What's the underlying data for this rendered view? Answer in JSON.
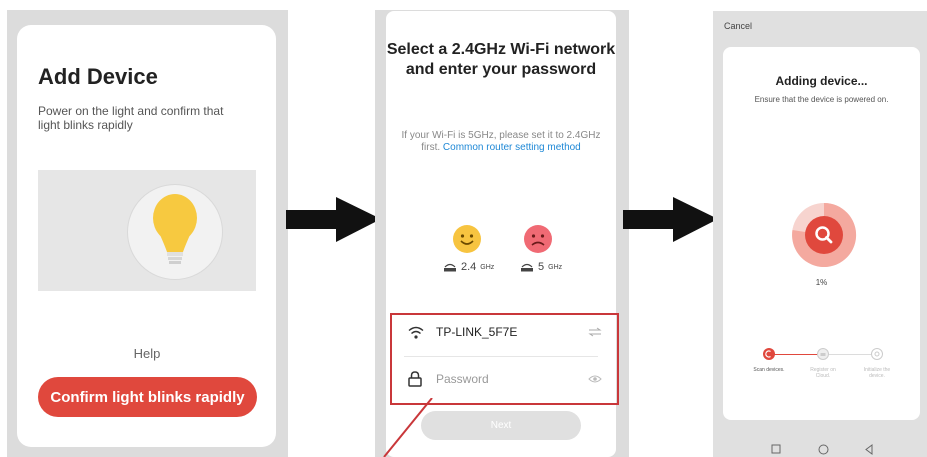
{
  "screen1": {
    "title": "Add Device",
    "description": "Power on the light and confirm that light blinks  rapidly",
    "help": "Help",
    "confirm_button": "Confirm light blinks rapidly"
  },
  "screen2": {
    "title": "Select a 2.4GHz Wi-Fi network and enter your password",
    "description": "If your Wi-Fi is 5GHz, please set it to 2.4GHz first.",
    "link": "Common router setting method",
    "bands": [
      {
        "value": "2.4",
        "unit": "GHz"
      },
      {
        "value": "5",
        "unit": "GHz"
      }
    ],
    "ssid": "TP-LINK_5F7E",
    "password_placeholder": "Password",
    "next_button": "Next"
  },
  "screen3": {
    "cancel": "Cancel",
    "title": "Adding device...",
    "subtitle": "Ensure that the device is powered on.",
    "progress": "1%",
    "steps": [
      {
        "label": "Scan devices."
      },
      {
        "label": "Register on Cloud."
      },
      {
        "label": "Initialize the device."
      }
    ]
  },
  "colors": {
    "accent_red": "#e0483d",
    "link_blue": "#1e88d6",
    "highlight_red": "#c9373a"
  }
}
